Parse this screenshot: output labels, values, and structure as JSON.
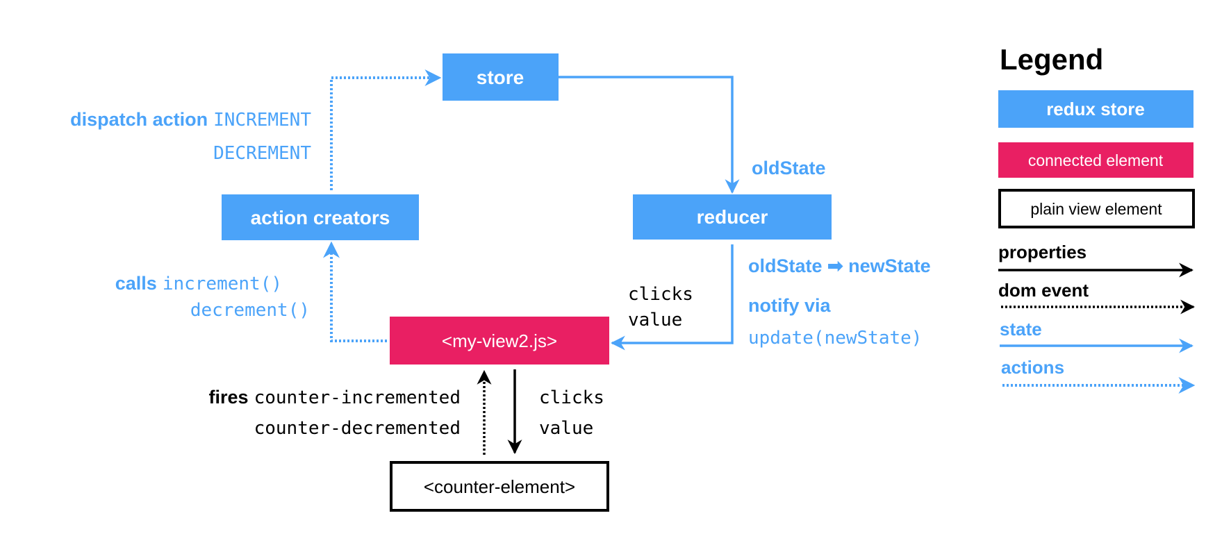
{
  "colors": {
    "redux_blue": "#4ba3f9",
    "connected_pink": "#e91f63",
    "plain_border": "#000000"
  },
  "nodes": {
    "store": "store",
    "action_creators": "action creators",
    "reducer": "reducer",
    "my_view": "<my-view2.js>",
    "counter_element": "<counter-element>"
  },
  "edges": {
    "dispatch": {
      "label": "dispatch action",
      "code1": "INCREMENT",
      "code2": "DECREMENT"
    },
    "old_state": "oldState",
    "reducer_out": {
      "transform": "oldState ➡ newState",
      "notify": "notify via",
      "code": "update(newState)"
    },
    "to_view": {
      "line1": "clicks",
      "line2": "value"
    },
    "calls": {
      "label": "calls",
      "code1": "increment()",
      "code2": "decrement()"
    },
    "fires": {
      "label": "fires",
      "code1": "counter-incremented",
      "code2": "counter-decremented"
    },
    "to_counter": {
      "line1": "clicks",
      "line2": "value"
    }
  },
  "legend": {
    "title": "Legend",
    "boxes": [
      "redux store",
      "connected element",
      "plain view element"
    ],
    "arrows": [
      "properties",
      "dom event",
      "state",
      "actions"
    ]
  }
}
